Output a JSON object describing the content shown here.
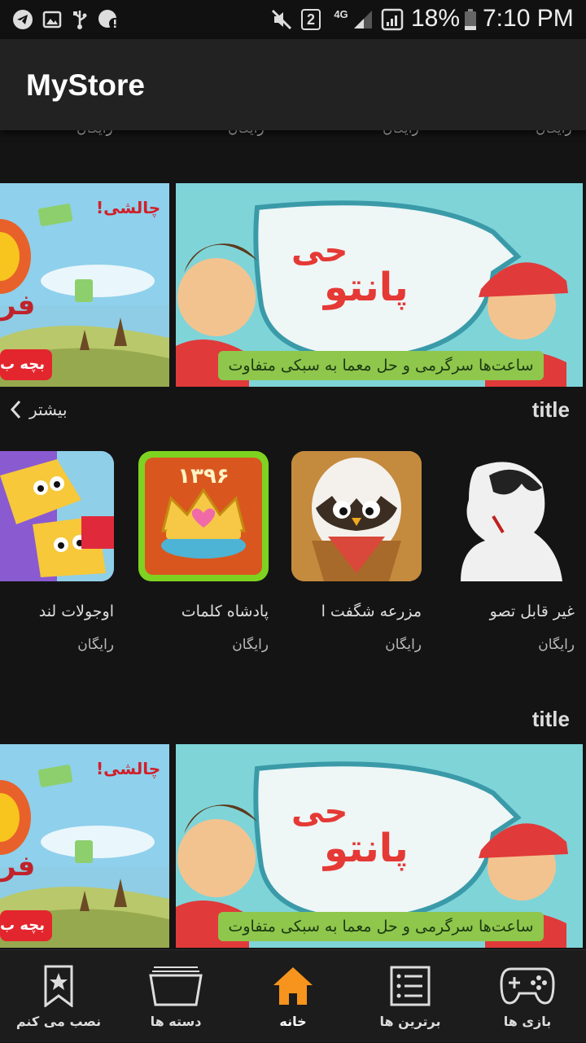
{
  "status_bar": {
    "sim_badge": "2",
    "network": "4G",
    "battery": "18%",
    "time": "7:10 PM"
  },
  "app_bar": {
    "title": "MyStore"
  },
  "ghost_prices": [
    "رایگان",
    "رایگان",
    "رایگان",
    "رایگان"
  ],
  "banners": {
    "main": {
      "headline_1": "حی",
      "headline_2": "پانتو",
      "caption": "ساعت‌ها سرگرمی و حل معما به سبکی متفاوت"
    },
    "side": {
      "challenge": "چالشی!",
      "partial_word": "فر",
      "partial_button": "بچه ب"
    }
  },
  "sections": [
    {
      "title": "title",
      "more_label": "بیشتر",
      "apps": [
        {
          "name": "غیر قابل تصو",
          "price": "رایگان",
          "icon": "silhouette-icon"
        },
        {
          "name": "مزرعه شگفت ا",
          "price": "رایگان",
          "icon": "egg-bird-icon"
        },
        {
          "name": "پادشاه کلمات",
          "price": "رایگان",
          "icon": "crown-icon",
          "badge": "۱۳۹۶"
        },
        {
          "name": "اوجولات لند",
          "price": "رایگان",
          "icon": "candy-face-icon"
        }
      ]
    },
    {
      "title": "title"
    }
  ],
  "bottom_nav": [
    {
      "label": "بازی ها",
      "icon": "gamepad-icon"
    },
    {
      "label": "برترین ها",
      "icon": "list-icon"
    },
    {
      "label": "خانه",
      "icon": "home-icon",
      "active": true
    },
    {
      "label": "دسته ها",
      "icon": "folder-icon"
    },
    {
      "label": "نصب می کنم",
      "icon": "bookmark-star-icon"
    }
  ],
  "colors": {
    "accent": "#F7941D",
    "background": "#141414",
    "app_bar": "#222222",
    "bottom_nav": "#1C1C1C"
  }
}
